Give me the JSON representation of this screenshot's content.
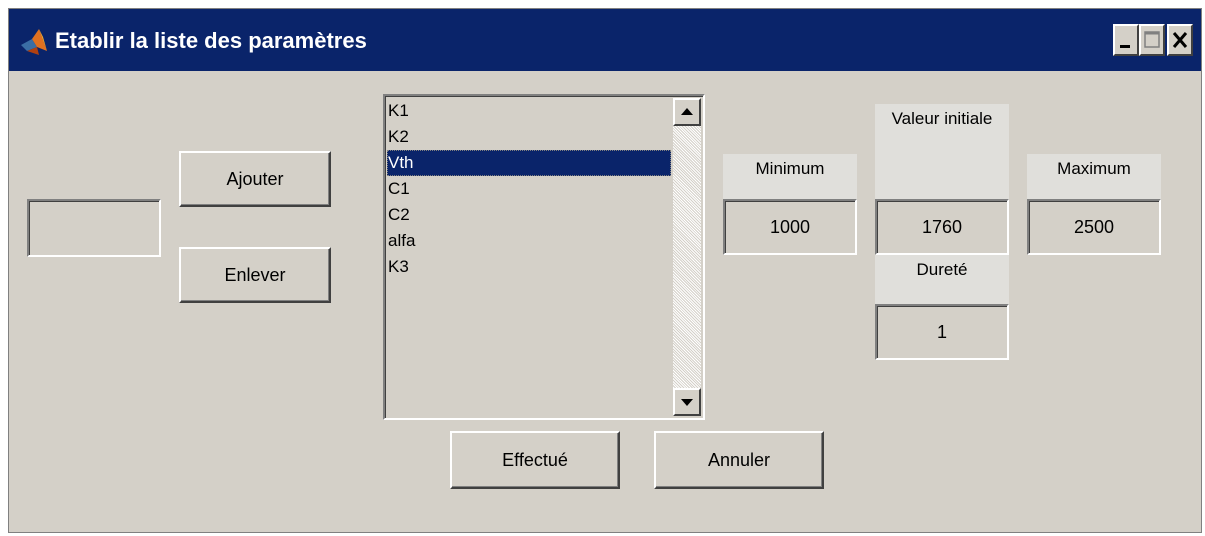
{
  "window": {
    "title": "Etablir la liste des paramètres"
  },
  "left": {
    "input_value": "",
    "add_button": "Ajouter",
    "remove_button": "Enlever"
  },
  "list": {
    "items": [
      "K1",
      "K2",
      "Vth",
      "C1",
      "C2",
      "alfa",
      "K3"
    ],
    "selected": "Vth"
  },
  "fields": {
    "minimum_label": "Minimum",
    "minimum_value": "1000",
    "initial_label": "Valeur initiale",
    "initial_value": "1760",
    "maximum_label": "Maximum",
    "maximum_value": "2500",
    "hardness_label": "Dureté",
    "hardness_value": "1"
  },
  "footer": {
    "done_button": "Effectué",
    "cancel_button": "Annuler"
  },
  "icons": [
    "matlab-logo-icon",
    "minimize-icon",
    "maximize-icon",
    "close-icon",
    "scroll-up-arrow-icon",
    "scroll-down-arrow-icon"
  ],
  "colors": {
    "titlebar": "#0a246a",
    "window_bg": "#d4d0c8",
    "selection": "#0a246a"
  }
}
